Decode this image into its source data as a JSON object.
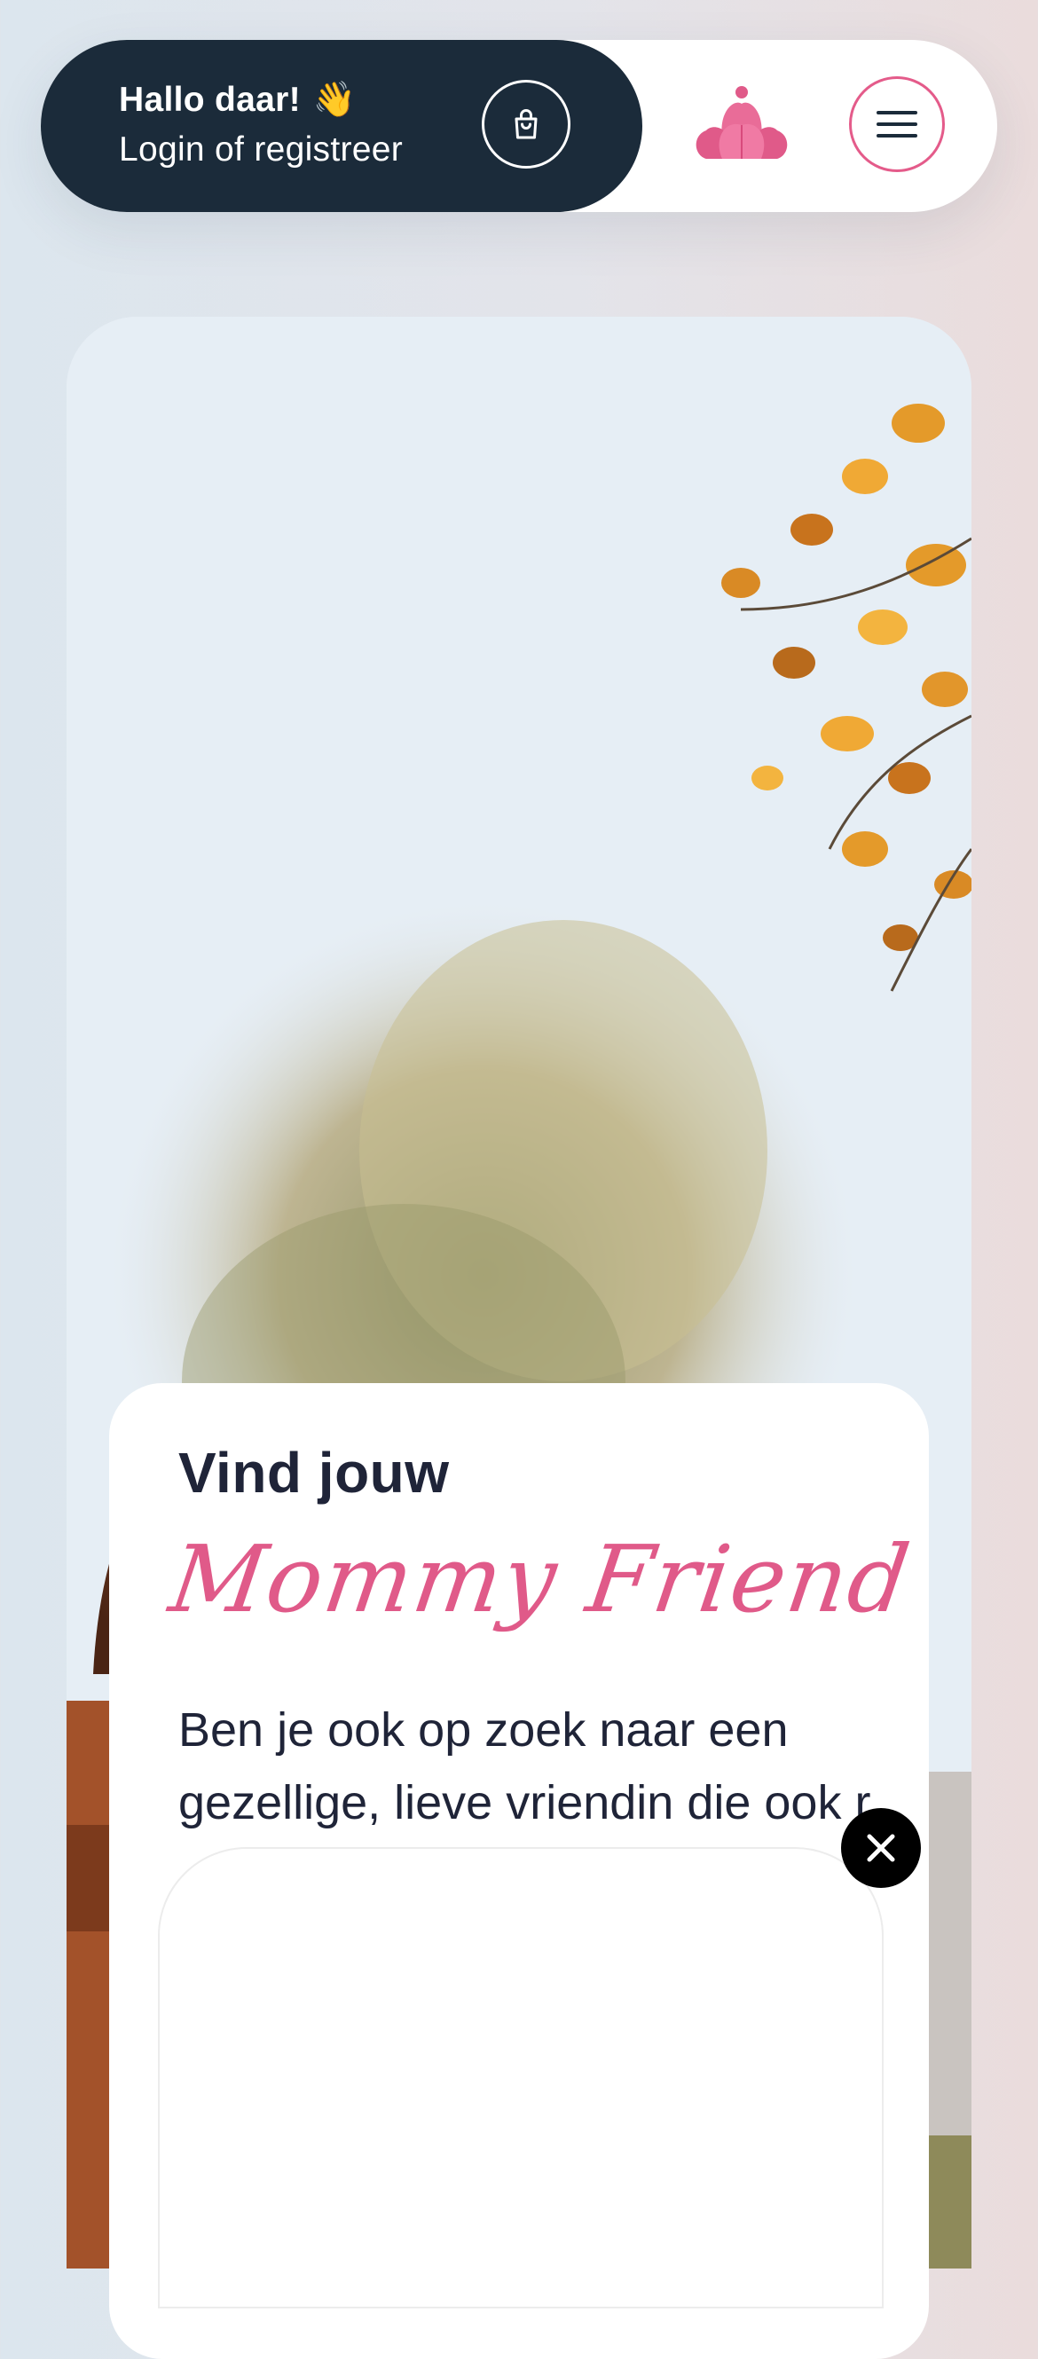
{
  "header": {
    "greeting": "Hallo daar!",
    "wave_emoji": "👋",
    "login_link": "Login of registreer",
    "cart_icon": "shopping-bag-icon",
    "logo_icon": "lotus-logo-icon",
    "menu_icon": "hamburger-menu-icon"
  },
  "hero": {
    "title": "Vind jouw",
    "script_title": "Mommy Friend",
    "text": "Ben je ook op zoek naar een gezellige, lieve vriendin die ook r"
  },
  "popup": {
    "close_icon": "close-icon"
  },
  "colors": {
    "dark": "#1b2b3a",
    "accent_pink": "#e05a89",
    "text": "#1f2438"
  }
}
